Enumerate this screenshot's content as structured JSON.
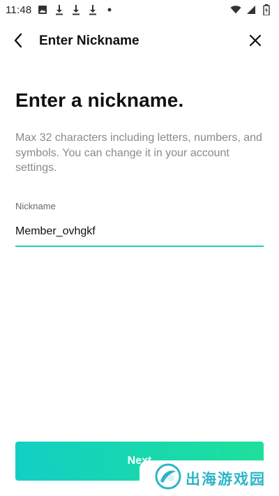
{
  "status_bar": {
    "time": "11:48",
    "left_icons": [
      "image-icon",
      "download-icon",
      "download-icon",
      "download-icon",
      "dot-icon"
    ],
    "right_icons": [
      "wifi-icon",
      "signal-icon",
      "battery-charging-icon"
    ]
  },
  "header": {
    "title": "Enter Nickname",
    "back_icon": "chevron-left-icon",
    "close_icon": "close-icon"
  },
  "main": {
    "heading": "Enter a nickname.",
    "description": "Max 32 characters including letters, numbers, and symbols. You can change it in your account settings.",
    "field_label": "Nickname",
    "field_value": "Member_ovhgkf"
  },
  "footer": {
    "next_label": "Next"
  },
  "watermark": {
    "text": "出海游戏园"
  },
  "colors": {
    "accent": "#1ad1b8",
    "button_start": "#12cfc4",
    "button_end": "#1ee09a",
    "watermark": "#2ab5c8"
  }
}
